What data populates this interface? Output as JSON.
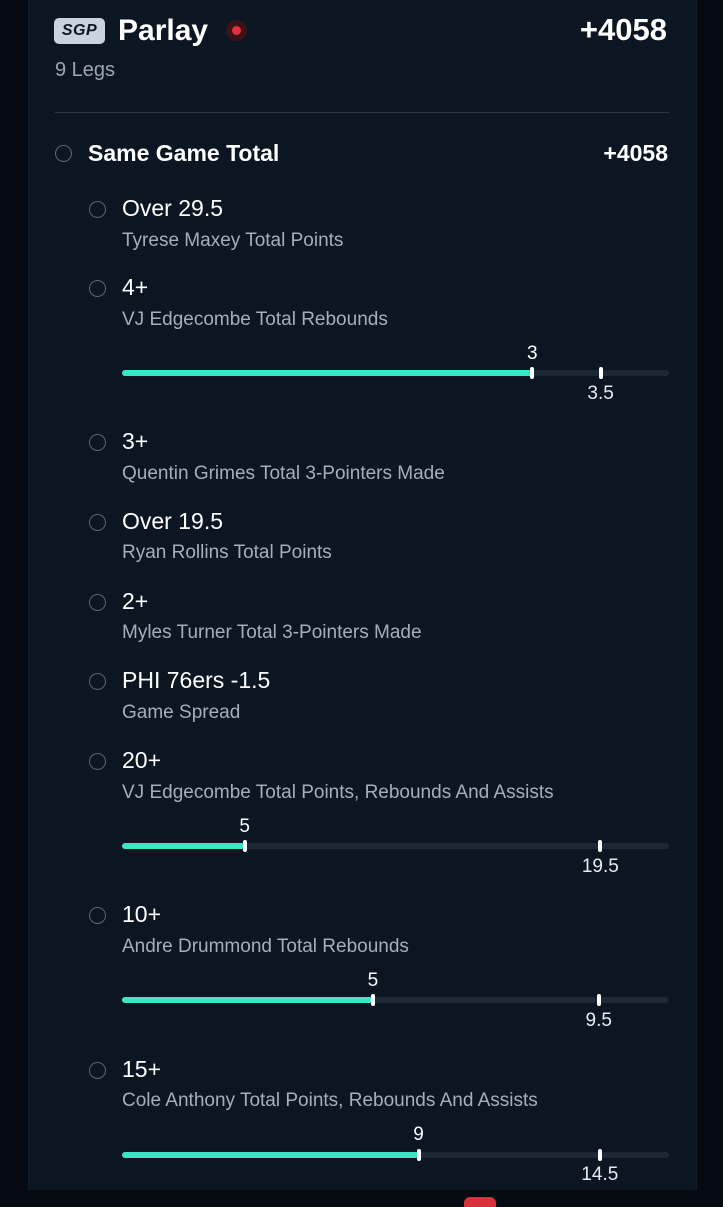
{
  "header": {
    "badge": "SGP",
    "title": "Parlay",
    "odds": "+4058",
    "legs": "9 Legs"
  },
  "section": {
    "title": "Same Game Total",
    "odds": "+4058"
  },
  "legs": [
    {
      "title": "Over 29.5",
      "subtitle": "Tyrese Maxey Total Points"
    },
    {
      "title": "4+",
      "subtitle": "VJ Edgecombe Total Rebounds",
      "progress": {
        "current": 3,
        "current_label": "3",
        "target": 3.5,
        "target_label": "3.5",
        "max": 4
      }
    },
    {
      "title": "3+",
      "subtitle": "Quentin Grimes Total 3-Pointers Made"
    },
    {
      "title": "Over 19.5",
      "subtitle": "Ryan Rollins Total Points"
    },
    {
      "title": "2+",
      "subtitle": "Myles Turner Total 3-Pointers Made"
    },
    {
      "title": "PHI 76ers -1.5",
      "subtitle": "Game Spread"
    },
    {
      "title": "20+",
      "subtitle": "VJ Edgecombe Total Points, Rebounds And Assists",
      "progress": {
        "current": 5,
        "current_label": "5",
        "target": 19.5,
        "target_label": "19.5",
        "max": 22.3
      }
    },
    {
      "title": "10+",
      "subtitle": "Andre Drummond Total Rebounds",
      "progress": {
        "current": 5,
        "current_label": "5",
        "target": 9.5,
        "target_label": "9.5",
        "max": 10.9
      }
    },
    {
      "title": "15+",
      "subtitle": "Cole Anthony Total Points, Rebounds And Assists",
      "progress": {
        "current": 9,
        "current_label": "9",
        "target": 14.5,
        "target_label": "14.5",
        "max": 16.6
      }
    }
  ],
  "colors": {
    "background": "#0b1622",
    "progress_fill": "#3ae6c4",
    "live_dot": "#e3313d",
    "badge": "#c7d3e0"
  }
}
